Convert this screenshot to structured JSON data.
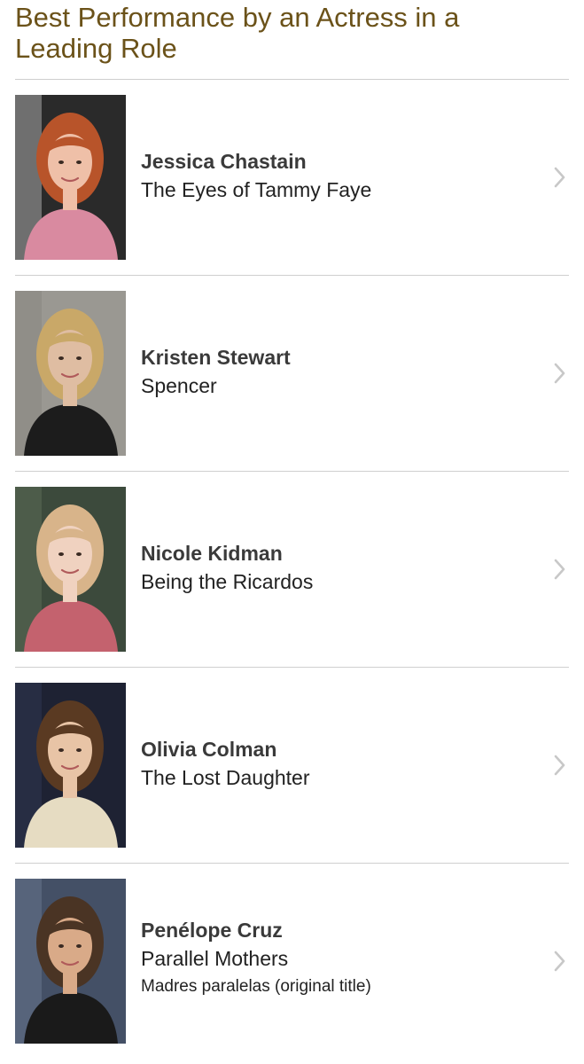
{
  "category": {
    "title": "Best Performance by an Actress in a Leading Role"
  },
  "nominees": [
    {
      "name": "Jessica Chastain",
      "film": "The Eyes of Tammy Faye",
      "note": "",
      "photo": {
        "bg": "#2a2a2a",
        "hair": "#b8542a",
        "skin": "#efc0a8",
        "clothing": "#d98aa0",
        "accent": "#f2f2f2"
      }
    },
    {
      "name": "Kristen Stewart",
      "film": "Spencer",
      "note": "",
      "photo": {
        "bg": "#9a9892",
        "hair": "#c9a868",
        "skin": "#dfbda2",
        "clothing": "#1c1c1c",
        "accent": "#7d7b76"
      }
    },
    {
      "name": "Nicole Kidman",
      "film": "Being the Ricardos",
      "note": "",
      "photo": {
        "bg": "#3c4a3c",
        "hair": "#d8b48a",
        "skin": "#f0d2c0",
        "clothing": "#c4626e",
        "accent": "#6d7d64"
      }
    },
    {
      "name": "Olivia Colman",
      "film": "The Lost Daughter",
      "note": "",
      "photo": {
        "bg": "#1e2233",
        "hair": "#5a3a22",
        "skin": "#e8c4a6",
        "clothing": "#e6dcc2",
        "accent": "#3a4160"
      }
    },
    {
      "name": "Penélope Cruz",
      "film": "Parallel Mothers",
      "note": "Madres paralelas (original title)",
      "photo": {
        "bg": "#445066",
        "hair": "#4a3424",
        "skin": "#d9aa88",
        "clothing": "#1a1a1a",
        "accent": "#7a8aa4"
      }
    }
  ],
  "icons": {
    "chevron": "chevron-right-icon"
  },
  "colors": {
    "title": "#6b5219",
    "divider": "#cfcfcf",
    "chevron": "#c8c8c8"
  }
}
